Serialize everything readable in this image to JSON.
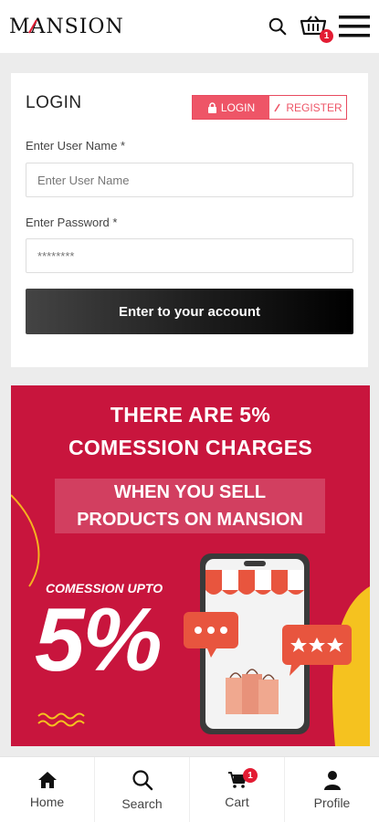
{
  "header": {
    "logo_text": "MANSION",
    "cart_count": "1"
  },
  "login": {
    "title": "LOGIN",
    "tab_login": "LOGIN",
    "tab_register": "REGISTER",
    "username_label": "Enter User Name *",
    "username_placeholder": "Enter User Name",
    "password_label": "Enter Password *",
    "password_placeholder": "********",
    "submit_label": "Enter to your account"
  },
  "banner": {
    "headline_1": "THERE ARE 5%",
    "headline_2": "COMESSION CHARGES",
    "sub_1": "WHEN YOU SELL",
    "sub_2": "PRODUCTS ON MANSION",
    "upto": "COMESSION UPTO",
    "big": "5%"
  },
  "bottom_nav": {
    "home": "Home",
    "search": "Search",
    "cart": "Cart",
    "cart_count": "1",
    "profile": "Profile"
  },
  "colors": {
    "brand_red": "#c8153d",
    "accent_pink": "#ee5567",
    "badge_red": "#e31c33"
  }
}
